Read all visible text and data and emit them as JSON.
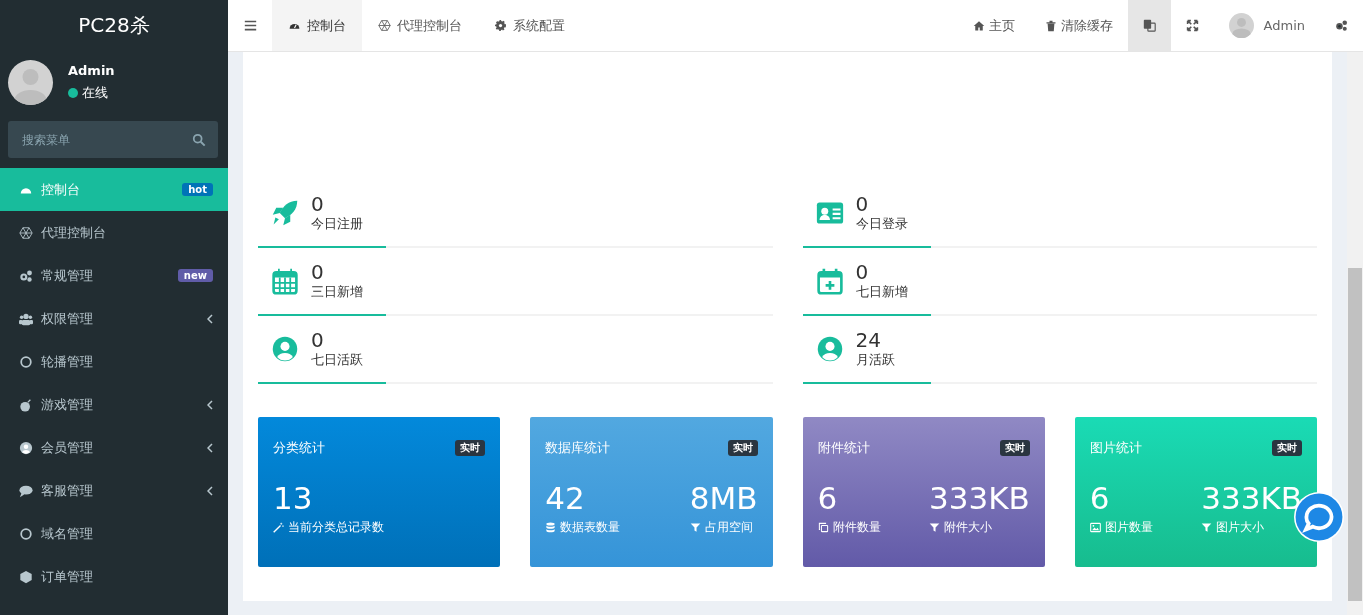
{
  "brand": "PC28杀",
  "user": {
    "name": "Admin",
    "status": "在线"
  },
  "search": {
    "placeholder": "搜索菜单"
  },
  "menu": [
    {
      "label": "控制台",
      "selected": true,
      "badge": {
        "text": "hot",
        "color": "#0073b7"
      },
      "expandable": false
    },
    {
      "label": "代理控制台",
      "selected": false,
      "expandable": false
    },
    {
      "label": "常规管理",
      "selected": false,
      "badge": {
        "text": "new",
        "color": "#605ca8"
      },
      "expandable": false
    },
    {
      "label": "权限管理",
      "selected": false,
      "expandable": true
    },
    {
      "label": "轮播管理",
      "selected": false,
      "expandable": false
    },
    {
      "label": "游戏管理",
      "selected": false,
      "expandable": true
    },
    {
      "label": "会员管理",
      "selected": false,
      "expandable": true
    },
    {
      "label": "客服管理",
      "selected": false,
      "expandable": true
    },
    {
      "label": "域名管理",
      "selected": false,
      "expandable": false
    },
    {
      "label": "订单管理",
      "selected": false,
      "expandable": false
    }
  ],
  "tabs": [
    {
      "label": "控制台",
      "selected": true
    },
    {
      "label": "代理控制台",
      "selected": false
    },
    {
      "label": "系统配置",
      "selected": false
    }
  ],
  "top_nav": [
    {
      "kind": "link",
      "label": "主页"
    },
    {
      "kind": "link",
      "label": "清除缓存"
    },
    {
      "kind": "icon",
      "selected": true
    },
    {
      "kind": "icon",
      "selected": false
    },
    {
      "kind": "user",
      "label": "Admin"
    },
    {
      "kind": "icon",
      "selected": false
    }
  ],
  "stats": [
    {
      "value": "0",
      "label": "今日注册"
    },
    {
      "value": "0",
      "label": "今日登录"
    },
    {
      "value": "0",
      "label": "三日新增"
    },
    {
      "value": "0",
      "label": "七日新增"
    },
    {
      "value": "0",
      "label": "七日活跃"
    },
    {
      "value": "24",
      "label": "月活跃"
    }
  ],
  "cards": [
    {
      "title": "分类统计",
      "tag": "实时",
      "metrics": [
        {
          "value": "13",
          "label": "当前分类总记录数"
        }
      ]
    },
    {
      "title": "数据库统计",
      "tag": "实时",
      "metrics": [
        {
          "value": "42",
          "label": "数据表数量"
        },
        {
          "value": "8MB",
          "label": "占用空间"
        }
      ]
    },
    {
      "title": "附件统计",
      "tag": "实时",
      "metrics": [
        {
          "value": "6",
          "label": "附件数量"
        },
        {
          "value": "333KB",
          "label": "附件大小"
        }
      ]
    },
    {
      "title": "图片统计",
      "tag": "实时",
      "metrics": [
        {
          "value": "6",
          "label": "图片数量"
        },
        {
          "value": "333KB",
          "label": "图片大小"
        }
      ]
    }
  ]
}
